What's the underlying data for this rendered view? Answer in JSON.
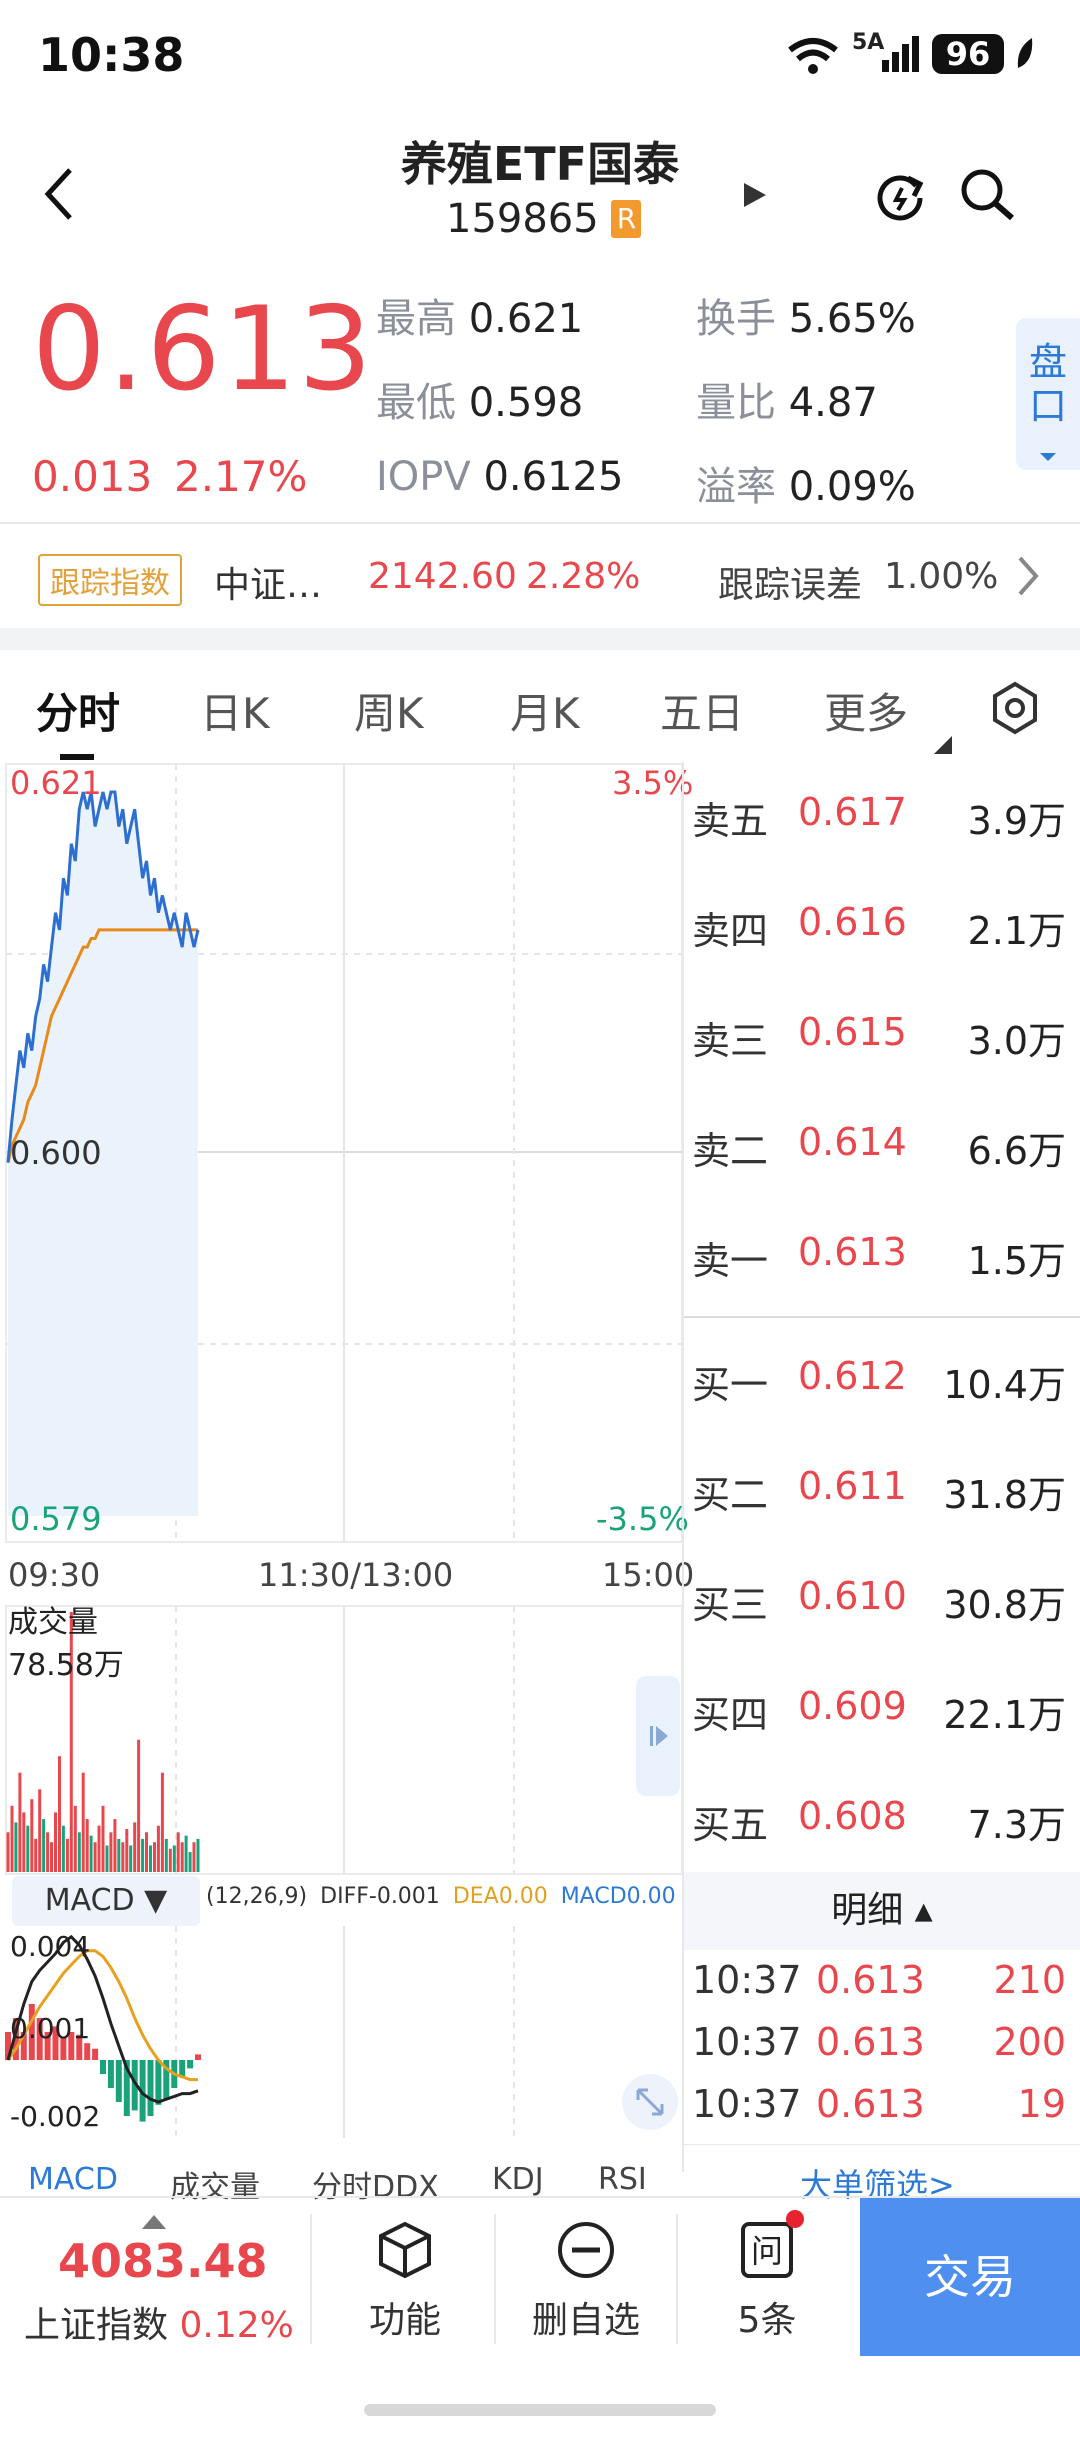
{
  "status_bar": {
    "time": "10:38",
    "network": "5A",
    "battery": "96"
  },
  "header": {
    "title": "养殖ETF国泰",
    "code": "159865",
    "badge": "R"
  },
  "quote": {
    "price": "0.613",
    "change": "0.013",
    "change_pct": "2.17%",
    "stats": [
      {
        "label": "最高",
        "value": "0.621"
      },
      {
        "label": "换手",
        "value": "5.65%"
      },
      {
        "label": "最低",
        "value": "0.598"
      },
      {
        "label": "量比",
        "value": "4.87"
      },
      {
        "label": "IOPV",
        "value": "0.6125"
      },
      {
        "label": "溢率",
        "value": "0.09%"
      }
    ],
    "side_tab": "盘口"
  },
  "tracking": {
    "tag": "跟踪指数",
    "index_name": "中证…",
    "index_value": "2142.60",
    "index_pct": "2.28%",
    "error_label": "跟踪误差",
    "error_value": "1.00%"
  },
  "tabs": [
    "分时",
    "日K",
    "周K",
    "月K",
    "五日",
    "更多"
  ],
  "chart": {
    "high_label": "0.621",
    "mid_label": "0.600",
    "low_label": "0.579",
    "pct_high": "3.5%",
    "pct_low": "-3.5%",
    "time_start": "09:30",
    "time_mid": "11:30/13:00",
    "time_end": "15:00",
    "volume_label": "成交量",
    "volume_value": "78.58万",
    "macd_select": "MACD ▼",
    "macd_params": "(12,26,9)",
    "diff": "DIFF-0.001",
    "dea": "DEA0.00",
    "macd_val": "MACD0.00",
    "macd_top": "0.004",
    "macd_mid": "0.001",
    "macd_bot": "-0.002"
  },
  "chart_data": {
    "type": "line",
    "x_range": [
      "09:30",
      "15:00"
    ],
    "ylim": [
      0.579,
      0.621
    ],
    "series": [],
    "price_line": [
      0.5995,
      0.602,
      0.604,
      0.606,
      0.605,
      0.607,
      0.606,
      0.608,
      0.609,
      0.611,
      0.61,
      0.612,
      0.614,
      0.613,
      0.616,
      0.615,
      0.618,
      0.617,
      0.62,
      0.621,
      0.62,
      0.621,
      0.619,
      0.62,
      0.621,
      0.62,
      0.621,
      0.621,
      0.619,
      0.62,
      0.618,
      0.619,
      0.62,
      0.618,
      0.616,
      0.617,
      0.615,
      0.616,
      0.614,
      0.615,
      0.614,
      0.613,
      0.614,
      0.613,
      0.612,
      0.614,
      0.613,
      0.612,
      0.613
    ],
    "avg_line": [
      0.5995,
      0.6005,
      0.601,
      0.6015,
      0.602,
      0.603,
      0.6035,
      0.604,
      0.605,
      0.606,
      0.607,
      0.608,
      0.6085,
      0.609,
      0.6095,
      0.61,
      0.6105,
      0.611,
      0.6115,
      0.612,
      0.612,
      0.6125,
      0.6125,
      0.613,
      0.613,
      0.613,
      0.613,
      0.613,
      0.613,
      0.613,
      0.613,
      0.613,
      0.613,
      0.613,
      0.613,
      0.613,
      0.613,
      0.613,
      0.613,
      0.613,
      0.613,
      0.613,
      0.613,
      0.613,
      0.613,
      0.613,
      0.613,
      0.613,
      0.613
    ],
    "volume": [
      12,
      20,
      15,
      30,
      18,
      14,
      22,
      10,
      25,
      16,
      12,
      9,
      18,
      35,
      14,
      10,
      78.58,
      20,
      12,
      30,
      16,
      11,
      9,
      14,
      20,
      8,
      12,
      16,
      10,
      9,
      13,
      8,
      15,
      40,
      10,
      12,
      8,
      9,
      14,
      30,
      10,
      7,
      8,
      12,
      9,
      11,
      6,
      9,
      10
    ],
    "volume_colors": [
      "r",
      "r",
      "g",
      "r",
      "r",
      "g",
      "r",
      "r",
      "r",
      "g",
      "r",
      "r",
      "r",
      "r",
      "g",
      "r",
      "r",
      "r",
      "g",
      "r",
      "r",
      "g",
      "r",
      "r",
      "r",
      "g",
      "r",
      "r",
      "g",
      "r",
      "r",
      "g",
      "r",
      "r",
      "g",
      "r",
      "g",
      "r",
      "r",
      "r",
      "g",
      "r",
      "g",
      "r",
      "r",
      "g",
      "g",
      "r",
      "g"
    ],
    "macd_hist": [
      0.001,
      0.0015,
      0.001,
      0.002,
      0.0015,
      0.001,
      0.0012,
      0.0008,
      0.001,
      0.0009,
      0.0006,
      0.0004,
      -0.0005,
      -0.001,
      -0.0015,
      -0.002,
      -0.0018,
      -0.0022,
      -0.002,
      -0.0016,
      -0.0014,
      -0.001,
      -0.0006,
      -0.0003,
      0.0002
    ],
    "diff_line": [
      0.0,
      0.001,
      0.002,
      0.0028,
      0.0032,
      0.0035,
      0.0038,
      0.0042,
      0.0044,
      0.0041,
      0.0036,
      0.003,
      0.0022,
      0.0013,
      0.0005,
      -0.0003,
      -0.0008,
      -0.0012,
      -0.0014,
      -0.0015,
      -0.0014,
      -0.0013,
      -0.0012,
      -0.0012,
      -0.0011
    ],
    "dea_line": [
      0.0,
      0.0004,
      0.0009,
      0.0014,
      0.0019,
      0.0023,
      0.0027,
      0.0031,
      0.0034,
      0.0037,
      0.0039,
      0.0039,
      0.0037,
      0.0033,
      0.0028,
      0.0022,
      0.0015,
      0.0009,
      0.0004,
      0.0,
      -0.0003,
      -0.0005,
      -0.0006,
      -0.0007,
      -0.0007
    ]
  },
  "order_book": {
    "asks": [
      {
        "label": "卖五",
        "price": "0.617",
        "vol": "3.9万"
      },
      {
        "label": "卖四",
        "price": "0.616",
        "vol": "2.1万"
      },
      {
        "label": "卖三",
        "price": "0.615",
        "vol": "3.0万"
      },
      {
        "label": "卖二",
        "price": "0.614",
        "vol": "6.6万"
      },
      {
        "label": "卖一",
        "price": "0.613",
        "vol": "1.5万"
      }
    ],
    "bids": [
      {
        "label": "买一",
        "price": "0.612",
        "vol": "10.4万"
      },
      {
        "label": "买二",
        "price": "0.611",
        "vol": "31.8万"
      },
      {
        "label": "买三",
        "price": "0.610",
        "vol": "30.8万"
      },
      {
        "label": "买四",
        "price": "0.609",
        "vol": "22.1万"
      },
      {
        "label": "买五",
        "price": "0.608",
        "vol": "7.3万"
      }
    ],
    "detail_label": "明细 ▴",
    "trades": [
      {
        "time": "10:37",
        "price": "0.613",
        "vol": "210"
      },
      {
        "time": "10:37",
        "price": "0.613",
        "vol": "200"
      },
      {
        "time": "10:37",
        "price": "0.613",
        "vol": "19"
      }
    ],
    "filter_link": "大单筛选>"
  },
  "indicator_tabs": [
    "MACD",
    "成交量",
    "分时DDX",
    "KDJ",
    "RSI"
  ],
  "bottom_bar": {
    "index_value": "4083.48",
    "index_name": "上证指数",
    "index_pct": "0.12%",
    "func_label": "功能",
    "remove_label": "删自选",
    "ask_label": "5条",
    "trade_label": "交易"
  },
  "colors": {
    "up": "#e8474d",
    "down": "#1aa37a",
    "accent": "#2d7ad6",
    "price_line": "#2d6fd1",
    "avg_line": "#e88a1a",
    "trade_btn": "#4f8ff0"
  }
}
